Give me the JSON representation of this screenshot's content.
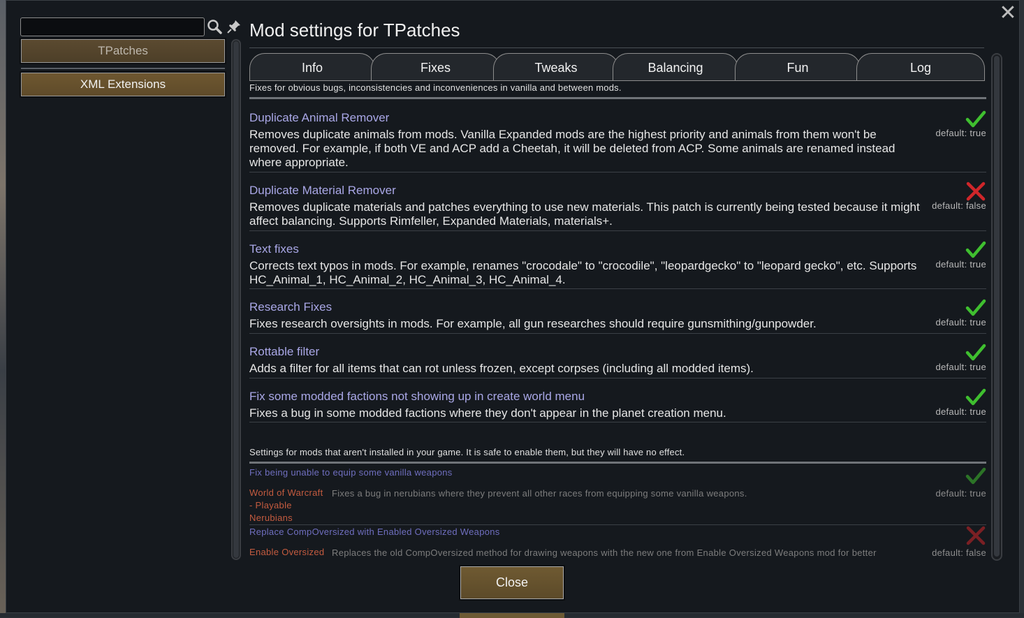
{
  "window": {
    "title": "Mod settings for TPatches",
    "close_label": "Close",
    "close_icon": "✕"
  },
  "sidebar": {
    "mods": [
      {
        "label": "TPatches",
        "selected": true
      },
      {
        "label": "XML Extensions",
        "selected": false
      }
    ]
  },
  "tabs": [
    {
      "label": "Info"
    },
    {
      "label": "Fixes"
    },
    {
      "label": "Tweaks"
    },
    {
      "label": "Balancing"
    },
    {
      "label": "Fun"
    },
    {
      "label": "Log"
    }
  ],
  "section": {
    "description": "Fixes for obvious bugs, inconsistencies and inconveniences in vanilla and between mods.",
    "settings": [
      {
        "title": "Duplicate Animal Remover",
        "description": "Removes duplicate animals from mods. Vanilla Expanded mods are the highest priority and animals from them won't be removed. For example, if both VE and ACP add a Cheetah, it will be deleted from ACP. Some animals are renamed instead where appropriate.",
        "enabled": true,
        "default": "default: true"
      },
      {
        "title": "Duplicate Material Remover",
        "description": "Removes duplicate materials and patches everything to use new materials. This patch is currently being tested because it might affect balancing. Supports Rimfeller, Expanded Materials, materials+.",
        "enabled": false,
        "default": "default: false"
      },
      {
        "title": "Text fixes",
        "description": "Corrects text typos in mods. For example, renames \"crocodale\" to \"crocodile\", \"leopardgecko\" to \"leopard gecko\", etc. Supports HC_Animal_1, HC_Animal_2, HC_Animal_3, HC_Animal_4.",
        "enabled": true,
        "default": "default: true"
      },
      {
        "title": "Research Fixes",
        "description": "Fixes research oversights in mods. For example, all gun researches should require gunsmithing/gunpowder.",
        "enabled": true,
        "default": "default: true"
      },
      {
        "title": "Rottable filter",
        "description": "Adds a filter for all items that can rot unless frozen, except corpses (including all modded items).",
        "enabled": true,
        "default": "default: true"
      },
      {
        "title": "Fix some modded factions not showing up in create world menu",
        "description": "Fixes a bug in some modded factions where they don't appear in the planet creation menu.",
        "enabled": true,
        "default": "default: true"
      }
    ]
  },
  "not_installed": {
    "description": "Settings for mods that aren't installed in your game. It is safe to enable them, but they will have no effect.",
    "settings": [
      {
        "title": "Fix being unable to equip some vanilla weapons",
        "mod_lines": [
          "World of Warcraft",
          "- Playable",
          "Nerubians"
        ],
        "description": "Fixes a bug in nerubians where they prevent all other races from equipping some vanilla weapons.",
        "enabled": true,
        "default": "default: true"
      },
      {
        "title": "Replace CompOversized with Enabled Oversized Weapons",
        "mod_lines": [
          "Enable Oversized"
        ],
        "description": "Replaces the old CompOversized method for drawing weapons with the new one from Enable Oversized Weapons mod for better",
        "enabled": false,
        "default": "default: false"
      }
    ]
  },
  "icons": {
    "search": "search-icon",
    "pin": "pin-icon",
    "check": "checkmark-icon",
    "cross": "cross-icon"
  },
  "colors": {
    "check": "#3fbf2f",
    "cross": "#d0262a",
    "title": "#a9a7e6",
    "mod_name": "#c45b3f",
    "button": "#6f5a32"
  }
}
